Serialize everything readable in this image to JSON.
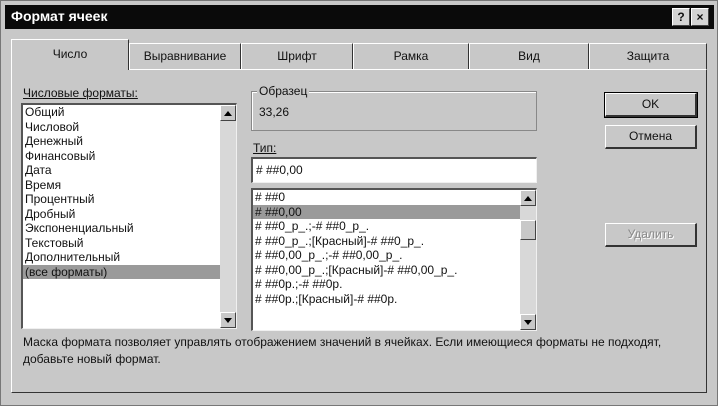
{
  "dialog": {
    "title": "Формат ячеек",
    "help_glyph": "?",
    "close_glyph": "×"
  },
  "tabs": [
    {
      "label": "Число",
      "active": true
    },
    {
      "label": "Выравнивание",
      "active": false
    },
    {
      "label": "Шрифт",
      "active": false
    },
    {
      "label": "Рамка",
      "active": false
    },
    {
      "label": "Вид",
      "active": false
    },
    {
      "label": "Защита",
      "active": false
    }
  ],
  "categories": {
    "label": "Числовые форматы:",
    "items": [
      "Общий",
      "Числовой",
      "Денежный",
      "Финансовый",
      "Дата",
      "Время",
      "Процентный",
      "Дробный",
      "Экспоненциальный",
      "Текстовый",
      "Дополнительный",
      "(все форматы)"
    ],
    "selected_index": 11
  },
  "sample": {
    "label": "Образец",
    "value": "33,26"
  },
  "type": {
    "label": "Тип:",
    "value": "# ##0,00",
    "options": [
      "# ##0",
      "# ##0,00",
      "# ##0_р_.;-# ##0_р_.",
      "# ##0_р_.;[Красный]-# ##0_р_.",
      "# ##0,00_р_.;-# ##0,00_р_.",
      "# ##0,00_р_.;[Красный]-# ##0,00_р_.",
      "# ##0р.;-# ##0р.",
      "# ##0р.;[Красный]-# ##0р."
    ],
    "selected_index": 1
  },
  "buttons": {
    "ok": "OK",
    "cancel": "Отмена",
    "delete": "Удалить"
  },
  "description": "Маска формата позволяет управлять отображением значений в ячейках. Если имеющиеся форматы не подходят, добавьте новый формат."
}
